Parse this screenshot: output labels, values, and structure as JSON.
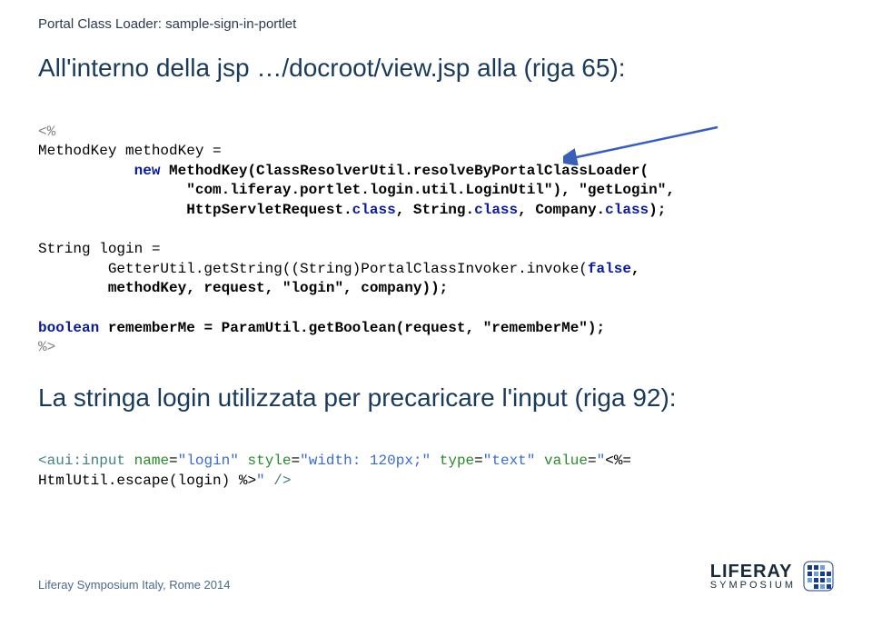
{
  "header": "Portal Class Loader: sample-sign-in-portlet",
  "title": "All'interno della jsp …/docroot/view.jsp alla (riga 65):",
  "code": {
    "l1a": "<%",
    "l2a": "MethodKey methodKey =",
    "l3pad": "           ",
    "l3new": "new",
    "l3a": " MethodKey(ClassResolverUtil.resolveByPortalClassLoader(",
    "l4pad": "                 ",
    "l4a": "\"com.liferay.portlet.login.util.LoginUtil\"), \"getLogin\",",
    "l5pad": "                 ",
    "l5a": "HttpServletRequest.",
    "l5cls": "class",
    "l5b": ", String.",
    "l5cls2": "class",
    "l5c": ", Company.",
    "l5cls3": "class",
    "l5d": ");",
    "l6": "",
    "l7a": "String login =",
    "l8pad": "        ",
    "l8a": "GetterUtil.getString((String)PortalClassInvoker.invoke(",
    "l8false": "false",
    "l8b": ",",
    "l9pad": "        ",
    "l9a": "methodKey, request, \"login\", company));",
    "l10": "",
    "l11bool": "boolean",
    "l11a": " rememberMe = ParamUtil.getBoolean(request, \"rememberMe\");",
    "l12a": "%>"
  },
  "subtitle": "La stringa login utilizzata per precaricare l'input (riga 92):",
  "code2": {
    "l1a": "<",
    "l1tag": "aui:input",
    "l1sp": " ",
    "l1attr1": "name",
    "l1eq1": "=",
    "l1val1": "\"login\"",
    "l1sp2": " ",
    "l1attr2": "style",
    "l1eq2": "=",
    "l1val2": "\"width: 120px;\"",
    "l1sp3": " ",
    "l1attr3": "type",
    "l1eq3": "=",
    "l1val3": "\"text\"",
    "l1sp4": " ",
    "l1attr4": "value",
    "l1eq4": "=",
    "l1val4a": "\"",
    "l1expr1": "<%=",
    "l2a": "HtmlUtil.escape(login) ",
    "l2expr": "%>",
    "l2q": "\"",
    "l2end": " />"
  },
  "footer": "Liferay Symposium Italy, Rome 2014",
  "logo": {
    "top": "LIFERAY",
    "bot": "SYMPOSIUM"
  }
}
